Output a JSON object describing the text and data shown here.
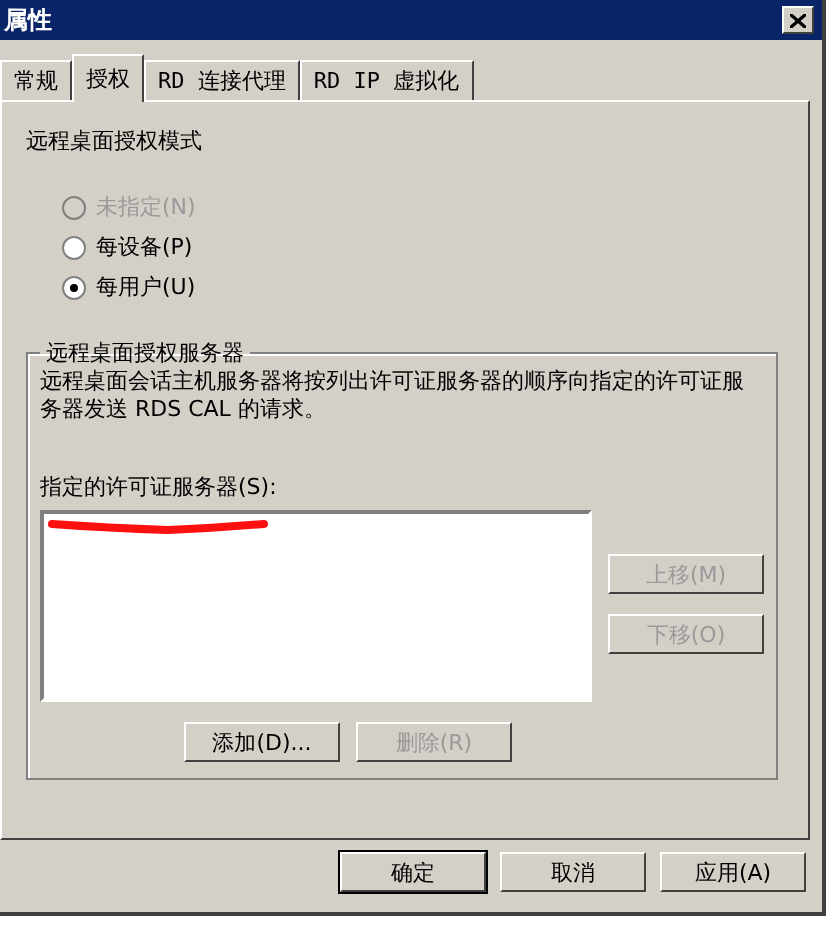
{
  "window": {
    "title": "属性"
  },
  "tabs": [
    {
      "label": "常规",
      "selected": false
    },
    {
      "label": "授权",
      "selected": true
    },
    {
      "label": "RD 连接代理",
      "selected": false
    },
    {
      "label": "RD IP 虚拟化",
      "selected": false
    }
  ],
  "mode": {
    "label": "远程桌面授权模式",
    "options": [
      {
        "label": "未指定(N)",
        "selected": false,
        "disabled": true
      },
      {
        "label": "每设备(P)",
        "selected": false,
        "disabled": false
      },
      {
        "label": "每用户(U)",
        "selected": true,
        "disabled": false
      }
    ]
  },
  "servers": {
    "legend": "远程桌面授权服务器",
    "description": "远程桌面会话主机服务器将按列出许可证服务器的顺序向指定的许可证服务器发送 RDS CAL 的请求。",
    "list_label": "指定的许可证服务器(S):",
    "side_buttons": [
      {
        "label": "上移(M)",
        "disabled": true
      },
      {
        "label": "下移(O)",
        "disabled": true
      }
    ],
    "bottom_buttons": [
      {
        "label": "添加(D)...",
        "disabled": false
      },
      {
        "label": "删除(R)",
        "disabled": true
      }
    ]
  },
  "dialog_buttons": [
    {
      "label": "确定",
      "default": true
    },
    {
      "label": "取消",
      "default": false
    },
    {
      "label": "应用(A)",
      "default": false
    }
  ]
}
